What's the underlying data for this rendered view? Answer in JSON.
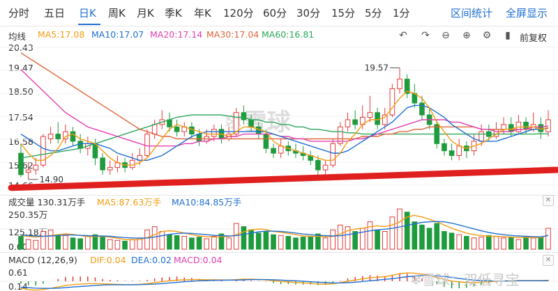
{
  "tabs": [
    {
      "label": "分时",
      "active": false
    },
    {
      "label": "五日",
      "active": false
    },
    {
      "label": "日K",
      "active": true
    },
    {
      "label": "周K",
      "active": false
    },
    {
      "label": "月K",
      "active": false
    },
    {
      "label": "季K",
      "active": false
    },
    {
      "label": "年K",
      "active": false
    },
    {
      "label": "120分",
      "active": false
    },
    {
      "label": "60分",
      "active": false
    },
    {
      "label": "30分",
      "active": false
    },
    {
      "label": "15分",
      "active": false
    },
    {
      "label": "5分",
      "active": false
    },
    {
      "label": "1分",
      "active": false
    }
  ],
  "actions": {
    "range_stats": "区间统计",
    "fullscreen": "全屏显示"
  },
  "ma_legend": {
    "title": "均线",
    "ma5": "MA5:17.08",
    "ma10": "MA10:17.07",
    "ma20": "MA20:17.14",
    "ma30": "MA30:17.04",
    "ma60": "MA60:16.81"
  },
  "toolbar": {
    "adjust_label": "前复权"
  },
  "price_axis": {
    "labels": [
      "20.43",
      "19.47",
      "18.50",
      "17.54",
      "16.58",
      "15.62",
      "14.66"
    ]
  },
  "annotations": {
    "high_label": "19.57",
    "low_label": "14.90"
  },
  "watermark": {
    "center": "雪球",
    "bottom_right": "雪球：双低寻宝"
  },
  "volume_panel": {
    "title": "成交量 130.31万手",
    "ma5": "MA5:87.63万手",
    "ma10": "MA10:84.85万手",
    "axis_labels": [
      "250.35万",
      "125.18万",
      "0.00"
    ]
  },
  "macd_panel": {
    "title": "MACD (12,26,9)",
    "dif": "DIF:0.04",
    "dea": "DEA:0.02",
    "macd": "MACD:0.04",
    "axis_labels": [
      "0.61",
      "0.14"
    ]
  },
  "colors": {
    "up": "#e33b3b",
    "down": "#1e9b3c",
    "ma5": "#f39c12",
    "ma10": "#1f6fd1",
    "ma20": "#e23fb0",
    "ma30": "#e0653a",
    "ma60": "#2aa65a",
    "accent": "#1f6fd1",
    "trendline": "#e01f1f"
  },
  "chart_data": {
    "type": "candlestick",
    "price_ylim": [
      14.66,
      20.43
    ],
    "candles": [
      [
        16.0,
        15.1,
        16.4,
        15.0
      ],
      [
        15.2,
        15.3,
        15.6,
        14.9
      ],
      [
        15.3,
        15.5,
        15.8,
        15.1
      ],
      [
        15.5,
        16.7,
        16.8,
        15.4
      ],
      [
        16.6,
        16.8,
        17.1,
        16.4
      ],
      [
        16.8,
        16.6,
        17.3,
        16.4
      ],
      [
        16.6,
        16.9,
        17.2,
        16.4
      ],
      [
        16.9,
        16.5,
        17.1,
        16.3
      ],
      [
        16.5,
        16.2,
        16.8,
        16.0
      ],
      [
        16.2,
        16.4,
        16.7,
        15.9
      ],
      [
        16.4,
        15.8,
        16.6,
        15.5
      ],
      [
        15.8,
        15.3,
        16.0,
        15.1
      ],
      [
        15.3,
        15.4,
        15.7,
        15.1
      ],
      [
        15.4,
        15.6,
        15.9,
        15.2
      ],
      [
        15.6,
        15.4,
        15.8,
        15.2
      ],
      [
        15.4,
        15.7,
        16.0,
        15.3
      ],
      [
        15.7,
        15.9,
        16.2,
        15.5
      ],
      [
        15.9,
        16.8,
        17.0,
        15.8
      ],
      [
        16.8,
        17.2,
        17.4,
        16.6
      ],
      [
        17.2,
        17.4,
        17.8,
        17.0
      ],
      [
        17.4,
        17.1,
        17.7,
        16.9
      ],
      [
        17.1,
        16.9,
        17.4,
        16.7
      ],
      [
        16.9,
        17.1,
        17.3,
        16.7
      ],
      [
        17.1,
        16.8,
        17.3,
        16.6
      ],
      [
        16.8,
        16.5,
        17.0,
        16.3
      ],
      [
        16.5,
        16.7,
        17.0,
        16.4
      ],
      [
        16.7,
        17.0,
        17.2,
        16.5
      ],
      [
        17.0,
        16.6,
        17.2,
        16.4
      ],
      [
        16.6,
        16.8,
        17.1,
        16.5
      ],
      [
        16.8,
        17.7,
        17.9,
        16.7
      ],
      [
        17.7,
        17.4,
        18.0,
        17.2
      ],
      [
        17.4,
        17.1,
        17.6,
        16.9
      ],
      [
        17.1,
        16.8,
        17.3,
        16.6
      ],
      [
        16.8,
        16.2,
        17.0,
        16.0
      ],
      [
        16.2,
        16.0,
        16.4,
        15.8
      ],
      [
        16.0,
        16.3,
        16.6,
        15.8
      ],
      [
        16.3,
        16.1,
        16.5,
        15.9
      ],
      [
        16.1,
        16.0,
        16.4,
        15.8
      ],
      [
        16.0,
        15.9,
        16.3,
        15.7
      ],
      [
        15.9,
        15.7,
        16.1,
        15.5
      ],
      [
        15.7,
        15.3,
        15.9,
        15.1
      ],
      [
        15.3,
        15.5,
        15.7,
        15.1
      ],
      [
        15.5,
        16.4,
        16.6,
        15.4
      ],
      [
        16.4,
        17.1,
        17.3,
        16.3
      ],
      [
        17.1,
        17.4,
        17.7,
        16.9
      ],
      [
        17.4,
        17.2,
        17.8,
        17.0
      ],
      [
        17.2,
        17.5,
        18.0,
        17.0
      ],
      [
        17.5,
        17.7,
        18.4,
        17.3
      ],
      [
        17.7,
        17.2,
        17.9,
        17.0
      ],
      [
        17.2,
        17.6,
        17.9,
        17.0
      ],
      [
        17.6,
        18.7,
        18.9,
        17.5
      ],
      [
        18.7,
        19.1,
        19.57,
        18.5
      ],
      [
        19.1,
        18.5,
        19.3,
        18.3
      ],
      [
        18.5,
        18.1,
        18.9,
        17.9
      ],
      [
        18.1,
        17.6,
        18.4,
        17.4
      ],
      [
        17.6,
        17.2,
        17.9,
        17.0
      ],
      [
        17.2,
        16.4,
        17.4,
        16.2
      ],
      [
        16.4,
        16.1,
        16.6,
        15.9
      ],
      [
        16.1,
        15.9,
        16.4,
        15.7
      ],
      [
        15.9,
        16.3,
        16.6,
        15.7
      ],
      [
        16.3,
        16.1,
        16.5,
        15.8
      ],
      [
        16.1,
        16.5,
        16.8,
        15.9
      ],
      [
        16.5,
        16.9,
        17.2,
        16.3
      ],
      [
        16.9,
        16.7,
        17.2,
        16.5
      ],
      [
        16.7,
        17.0,
        17.3,
        16.6
      ],
      [
        17.0,
        17.2,
        17.5,
        16.8
      ],
      [
        17.2,
        16.9,
        17.5,
        16.7
      ],
      [
        16.9,
        17.3,
        17.6,
        16.8
      ],
      [
        17.3,
        17.0,
        17.5,
        16.8
      ],
      [
        17.0,
        17.2,
        17.7,
        16.9
      ],
      [
        17.2,
        16.9,
        17.5,
        16.6
      ],
      [
        16.9,
        17.4,
        17.8,
        16.7
      ]
    ],
    "ma5": [
      16.4,
      16.0,
      15.7,
      15.7,
      15.9,
      16.2,
      16.7,
      16.8,
      16.6,
      16.5,
      16.4,
      16.1,
      15.8,
      15.6,
      15.5,
      15.5,
      15.6,
      15.8,
      16.2,
      16.6,
      17.0,
      17.2,
      17.1,
      17.0,
      16.9,
      16.8,
      16.8,
      16.8,
      16.7,
      16.9,
      17.1,
      17.1,
      17.0,
      16.9,
      16.5,
      16.3,
      16.2,
      16.1,
      16.0,
      15.9,
      15.8,
      15.7,
      15.7,
      16.0,
      16.5,
      16.8,
      17.2,
      17.4,
      17.4,
      17.5,
      17.9,
      18.3,
      18.6,
      18.5,
      18.3,
      17.9,
      17.3,
      16.9,
      16.5,
      16.3,
      16.2,
      16.3,
      16.4,
      16.6,
      16.8,
      17.0,
      17.0,
      17.1,
      17.1,
      17.1,
      17.0,
      17.08
    ],
    "ma10": [
      16.8,
      16.6,
      16.4,
      16.2,
      16.1,
      16.1,
      16.2,
      16.3,
      16.4,
      16.4,
      16.4,
      16.3,
      16.2,
      16.0,
      15.9,
      15.8,
      15.7,
      15.7,
      15.8,
      15.9,
      16.1,
      16.3,
      16.5,
      16.7,
      16.8,
      16.9,
      16.9,
      16.9,
      16.9,
      16.9,
      16.9,
      16.9,
      16.9,
      16.9,
      16.8,
      16.7,
      16.6,
      16.5,
      16.4,
      16.3,
      16.2,
      16.1,
      16.0,
      16.0,
      16.1,
      16.3,
      16.5,
      16.7,
      16.9,
      17.1,
      17.3,
      17.6,
      17.9,
      18.0,
      18.0,
      17.9,
      17.7,
      17.5,
      17.2,
      17.0,
      16.8,
      16.6,
      16.5,
      16.5,
      16.5,
      16.6,
      16.7,
      16.8,
      16.9,
      17.0,
      17.0,
      17.07
    ],
    "ma20": [
      19.5,
      19.2,
      18.9,
      18.6,
      18.3,
      18.0,
      17.7,
      17.5,
      17.3,
      17.1,
      17.0,
      16.9,
      16.8,
      16.7,
      16.6,
      16.5,
      16.4,
      16.3,
      16.3,
      16.3,
      16.3,
      16.3,
      16.4,
      16.4,
      16.5,
      16.5,
      16.6,
      16.6,
      16.7,
      16.7,
      16.8,
      16.8,
      16.8,
      16.8,
      16.8,
      16.7,
      16.7,
      16.6,
      16.6,
      16.5,
      16.5,
      16.5,
      16.5,
      16.5,
      16.5,
      16.6,
      16.6,
      16.7,
      16.8,
      16.9,
      17.0,
      17.1,
      17.2,
      17.3,
      17.4,
      17.4,
      17.4,
      17.4,
      17.3,
      17.3,
      17.2,
      17.1,
      17.0,
      17.0,
      16.9,
      16.9,
      16.9,
      17.0,
      17.0,
      17.1,
      17.1,
      17.14
    ],
    "ma30": [
      20.2,
      20.0,
      19.8,
      19.6,
      19.4,
      19.2,
      19.0,
      18.8,
      18.6,
      18.4,
      18.2,
      18.0,
      17.8,
      17.6,
      17.4,
      17.2,
      17.0,
      16.9,
      16.8,
      16.7,
      16.7,
      16.6,
      16.6,
      16.6,
      16.6,
      16.6,
      16.6,
      16.6,
      16.6,
      16.6,
      16.6,
      16.6,
      16.6,
      16.6,
      16.6,
      16.6,
      16.6,
      16.6,
      16.6,
      16.6,
      16.6,
      16.6,
      16.6,
      16.6,
      16.6,
      16.6,
      16.7,
      16.7,
      16.7,
      16.8,
      16.8,
      16.9,
      16.9,
      17.0,
      17.0,
      17.1,
      17.1,
      17.1,
      17.1,
      17.1,
      17.1,
      17.1,
      17.0,
      17.0,
      17.0,
      17.0,
      17.0,
      17.0,
      17.0,
      17.0,
      17.0,
      17.04
    ],
    "ma60": [
      15.8,
      15.85,
      15.9,
      15.95,
      16.0,
      16.05,
      16.1,
      16.15,
      16.2,
      16.3,
      16.4,
      16.5,
      16.6,
      16.7,
      16.8,
      16.9,
      17.0,
      17.1,
      17.2,
      17.3,
      17.4,
      17.5,
      17.55,
      17.6,
      17.6,
      17.6,
      17.6,
      17.6,
      17.55,
      17.5,
      17.5,
      17.4,
      17.4,
      17.3,
      17.3,
      17.2,
      17.2,
      17.1,
      17.1,
      17.0,
      17.0,
      16.95,
      16.9,
      16.9,
      16.85,
      16.85,
      16.8,
      16.8,
      16.8,
      16.8,
      16.8,
      16.8,
      16.8,
      16.8,
      16.8,
      16.8,
      16.8,
      16.8,
      16.8,
      16.8,
      16.8,
      16.8,
      16.8,
      16.8,
      16.8,
      16.8,
      16.8,
      16.8,
      16.8,
      16.8,
      16.81,
      16.81
    ],
    "volume_ylim": [
      0,
      250.35
    ],
    "volume": [
      80,
      60,
      55,
      110,
      120,
      90,
      85,
      70,
      65,
      80,
      90,
      75,
      60,
      55,
      50,
      60,
      70,
      120,
      140,
      110,
      90,
      85,
      80,
      70,
      75,
      65,
      80,
      95,
      70,
      160,
      140,
      120,
      100,
      110,
      90,
      85,
      80,
      70,
      75,
      80,
      95,
      70,
      120,
      150,
      140,
      110,
      130,
      170,
      120,
      110,
      200,
      250,
      230,
      170,
      150,
      130,
      160,
      110,
      100,
      90,
      80,
      70,
      75,
      85,
      80,
      70,
      75,
      60,
      80,
      70,
      75,
      130
    ],
    "volume_ma5": [
      85,
      80,
      75,
      80,
      85,
      90,
      95,
      92,
      85,
      78,
      78,
      80,
      75,
      68,
      60,
      58,
      60,
      72,
      90,
      110,
      115,
      110,
      100,
      90,
      82,
      78,
      75,
      78,
      80,
      90,
      108,
      120,
      125,
      122,
      110,
      105,
      98,
      90,
      82,
      80,
      80,
      78,
      80,
      95,
      115,
      125,
      130,
      140,
      145,
      140,
      150,
      170,
      200,
      210,
      200,
      185,
      170,
      150,
      130,
      115,
      100,
      90,
      85,
      80,
      80,
      78,
      75,
      72,
      73,
      72,
      72,
      87.63
    ],
    "volume_ma10": [
      88,
      85,
      82,
      80,
      82,
      85,
      88,
      88,
      86,
      84,
      82,
      82,
      80,
      76,
      72,
      70,
      68,
      70,
      76,
      84,
      92,
      98,
      100,
      98,
      94,
      90,
      86,
      84,
      82,
      85,
      92,
      100,
      108,
      112,
      112,
      110,
      106,
      100,
      94,
      90,
      86,
      84,
      82,
      84,
      90,
      98,
      106,
      114,
      120,
      124,
      130,
      138,
      148,
      158,
      166,
      170,
      172,
      170,
      162,
      150,
      138,
      126,
      114,
      104,
      96,
      90,
      85,
      82,
      80,
      78,
      77,
      84.85
    ],
    "macd_dif": [
      -0.3,
      -0.35,
      -0.38,
      -0.35,
      -0.3,
      -0.24,
      -0.18,
      -0.14,
      -0.12,
      -0.1,
      -0.1,
      -0.11,
      -0.12,
      -0.13,
      -0.14,
      -0.14,
      -0.13,
      -0.1,
      -0.06,
      -0.02,
      0.02,
      0.05,
      0.06,
      0.07,
      0.07,
      0.06,
      0.06,
      0.06,
      0.05,
      0.07,
      0.09,
      0.09,
      0.08,
      0.06,
      0.02,
      -0.01,
      -0.03,
      -0.05,
      -0.07,
      -0.09,
      -0.12,
      -0.13,
      -0.11,
      -0.06,
      0.0,
      0.05,
      0.1,
      0.15,
      0.17,
      0.19,
      0.25,
      0.32,
      0.35,
      0.34,
      0.3,
      0.25,
      0.16,
      0.08,
      0.01,
      -0.03,
      -0.06,
      -0.06,
      -0.04,
      -0.02,
      0.0,
      0.02,
      0.02,
      0.03,
      0.03,
      0.03,
      0.03,
      0.04
    ],
    "macd_dea": [
      -0.25,
      -0.27,
      -0.29,
      -0.3,
      -0.3,
      -0.29,
      -0.27,
      -0.24,
      -0.22,
      -0.2,
      -0.18,
      -0.16,
      -0.15,
      -0.15,
      -0.15,
      -0.15,
      -0.14,
      -0.13,
      -0.12,
      -0.1,
      -0.07,
      -0.05,
      -0.02,
      0.0,
      0.02,
      0.03,
      0.04,
      0.04,
      0.05,
      0.05,
      0.06,
      0.07,
      0.07,
      0.07,
      0.06,
      0.05,
      0.03,
      0.02,
      0.0,
      -0.02,
      -0.04,
      -0.06,
      -0.07,
      -0.07,
      -0.06,
      -0.04,
      -0.01,
      0.02,
      0.05,
      0.08,
      0.11,
      0.15,
      0.19,
      0.22,
      0.24,
      0.24,
      0.23,
      0.2,
      0.16,
      0.12,
      0.08,
      0.05,
      0.03,
      0.02,
      0.01,
      0.01,
      0.01,
      0.02,
      0.02,
      0.02,
      0.02,
      0.02
    ]
  }
}
